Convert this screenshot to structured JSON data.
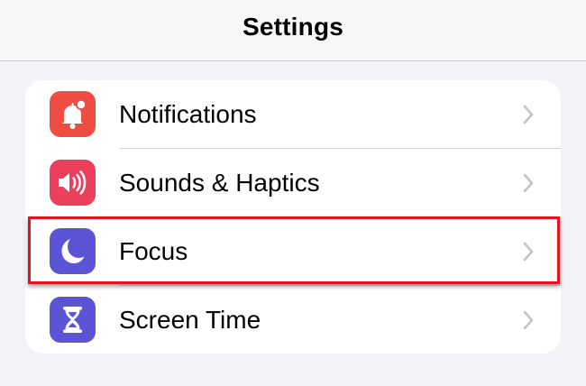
{
  "header": {
    "title": "Settings"
  },
  "settings": {
    "items": [
      {
        "label": "Notifications",
        "icon": "bell-icon",
        "icon_color": "#ef4d43"
      },
      {
        "label": "Sounds & Haptics",
        "icon": "speaker-icon",
        "icon_color": "#ec3f5c"
      },
      {
        "label": "Focus",
        "icon": "moon-icon",
        "icon_color": "#5b55d6"
      },
      {
        "label": "Screen Time",
        "icon": "hourglass-icon",
        "icon_color": "#5b55d6"
      }
    ]
  },
  "highlight": {
    "target": "Focus",
    "color": "#e3141e"
  }
}
